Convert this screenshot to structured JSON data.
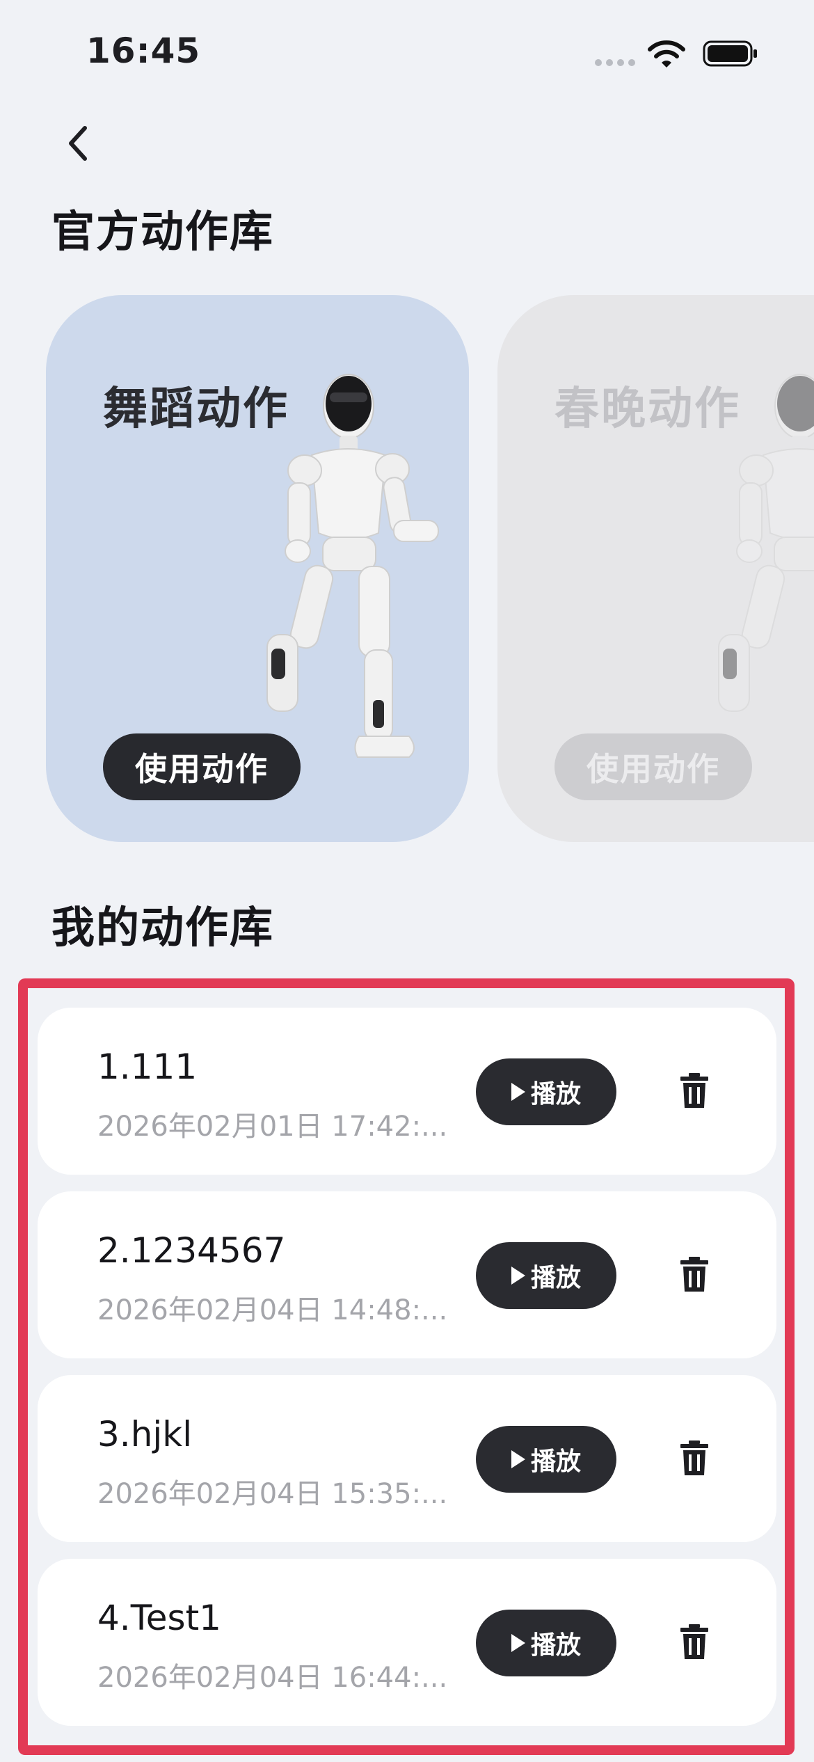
{
  "status_bar": {
    "time": "16:45"
  },
  "header": {
    "back_icon": "chevron-left-icon"
  },
  "official_library": {
    "title": "官方动作库",
    "cards": [
      {
        "title": "舞蹈动作",
        "button_label": "使用动作",
        "active": true
      },
      {
        "title": "春晚动作",
        "button_label": "使用动作",
        "active": false
      }
    ]
  },
  "my_library": {
    "title": "我的动作库",
    "items": [
      {
        "name": "1.111",
        "time": "2026年02月01日 17:42:...",
        "play_label": "播放"
      },
      {
        "name": "2.1234567",
        "time": "2026年02月04日 14:48:...",
        "play_label": "播放"
      },
      {
        "name": "3.hjkl",
        "time": "2026年02月04日 15:35:...",
        "play_label": "播放"
      },
      {
        "name": "4.Test1",
        "time": "2026年02月04日 16:44:...",
        "play_label": "播放"
      }
    ]
  },
  "colors": {
    "background": "#f0f2f6",
    "dance_card": "#cdd9ec",
    "gala_card": "#e6e6e8",
    "dark_button": "#28292e",
    "annotation": "#e23a55"
  }
}
